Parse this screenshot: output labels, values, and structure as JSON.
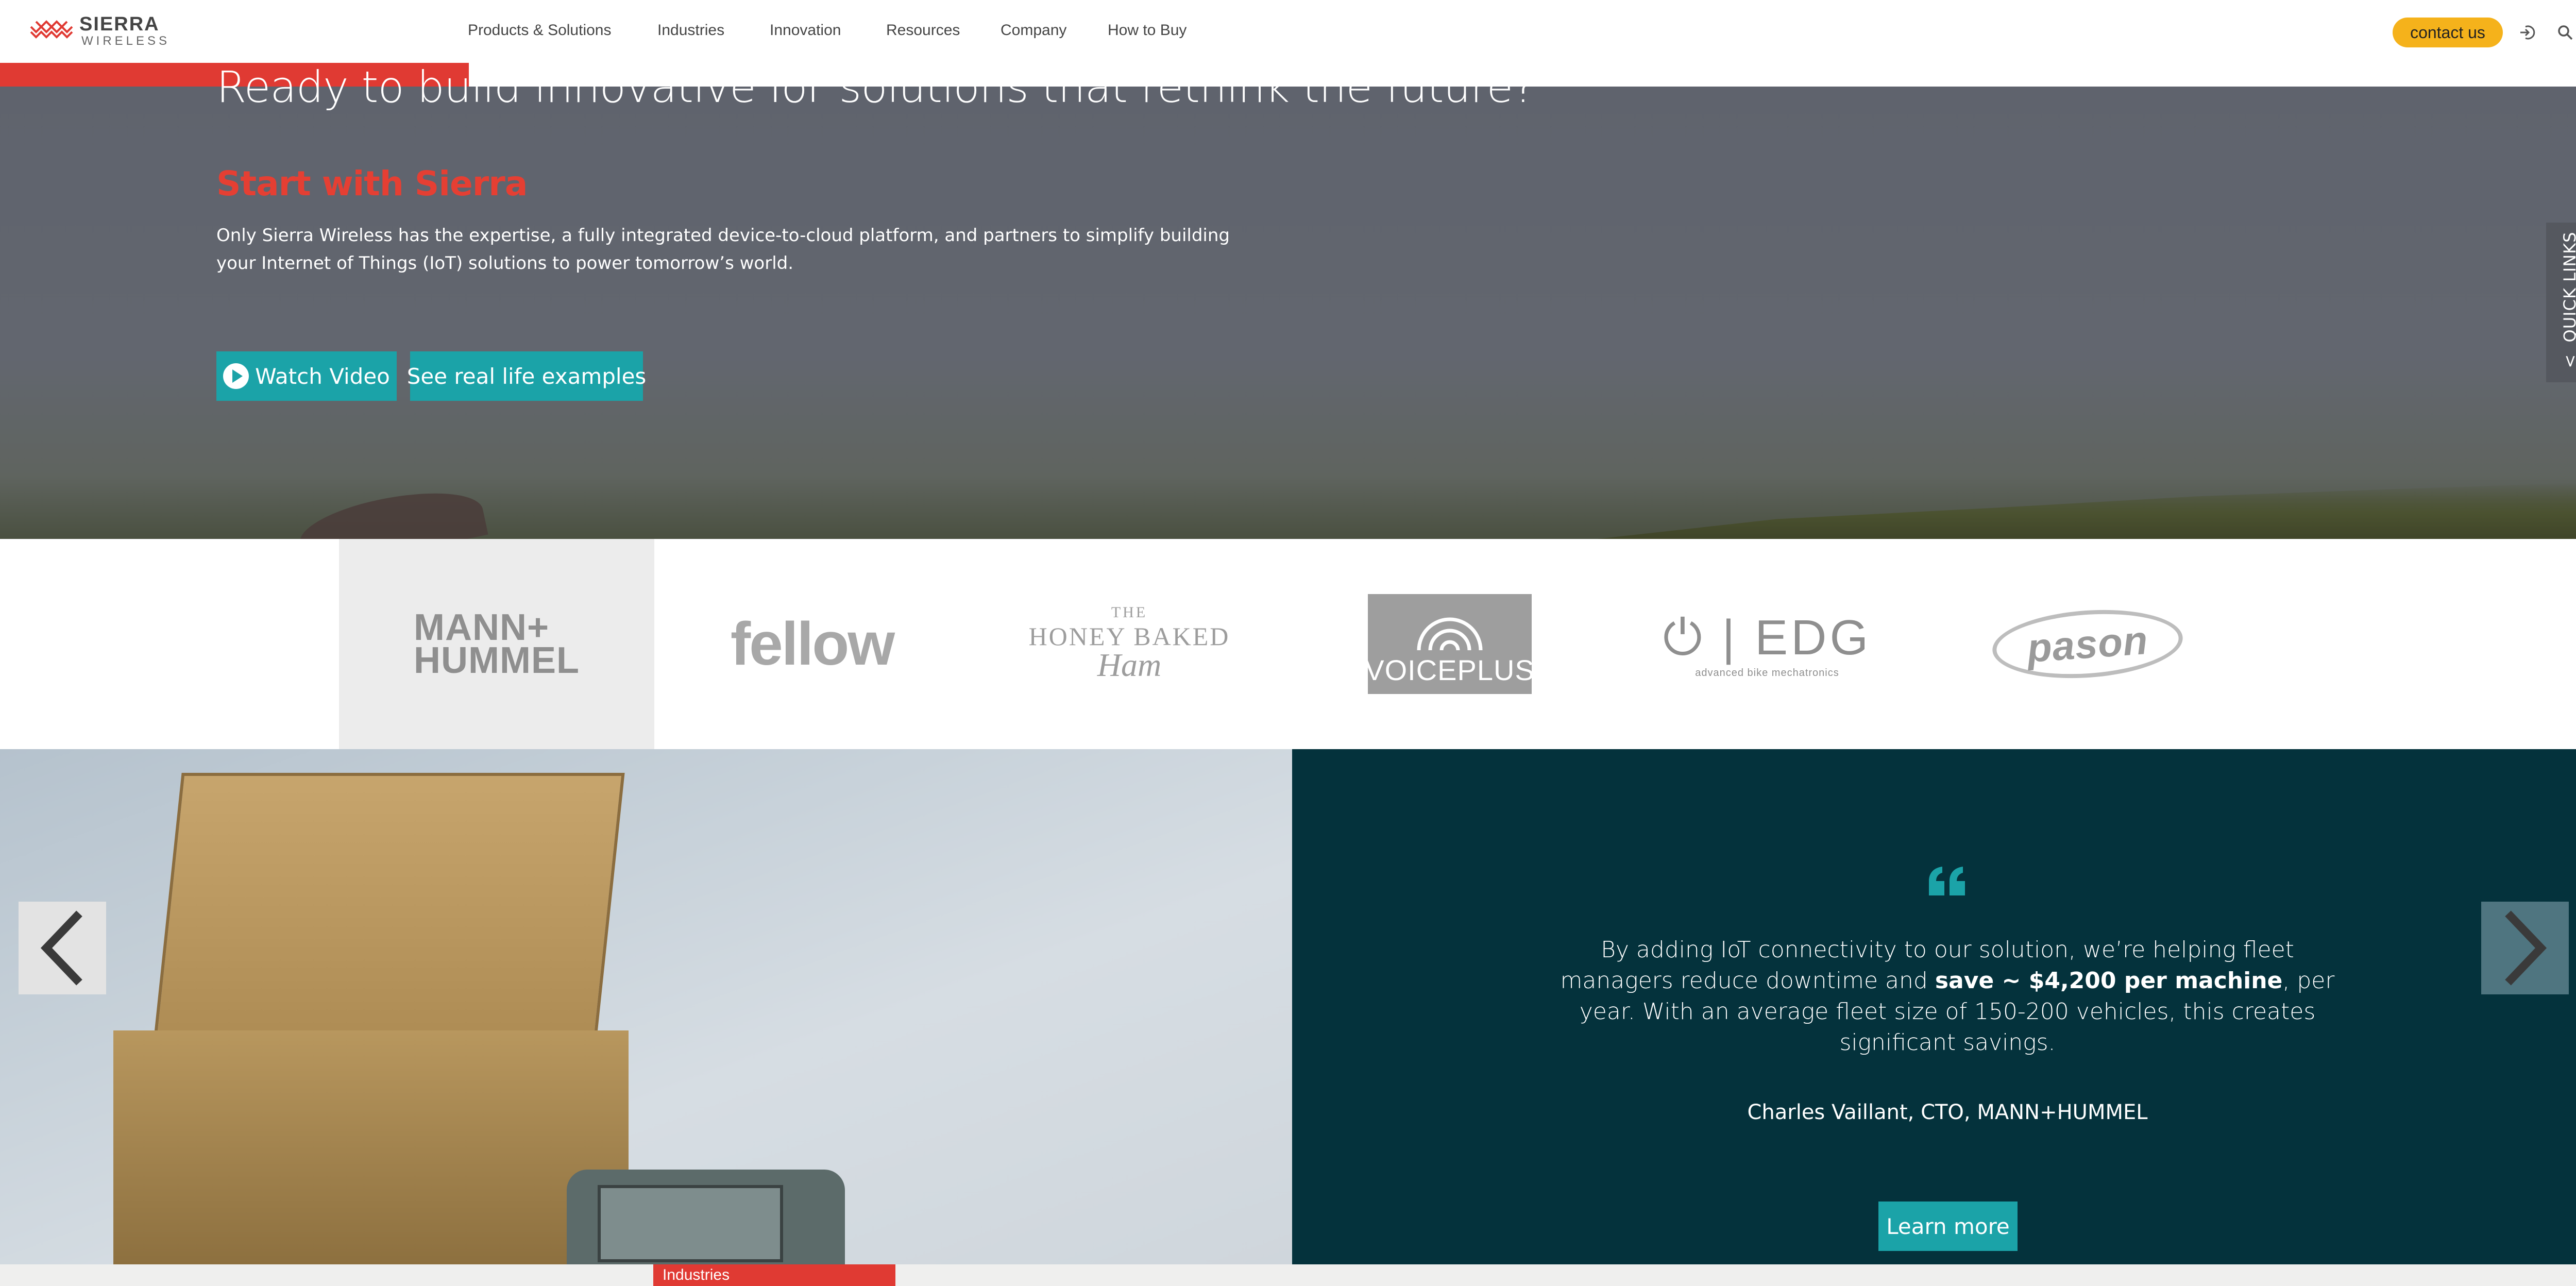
{
  "header": {
    "logo": {
      "line1": "SIERRA",
      "line2": "WIRELESS"
    },
    "nav": [
      {
        "label": "Products & Solutions"
      },
      {
        "label": "Industries"
      },
      {
        "label": "Innovation"
      },
      {
        "label": "Resources"
      },
      {
        "label": "Company"
      },
      {
        "label": "How to Buy"
      }
    ],
    "contact_label": "contact us"
  },
  "hero": {
    "title": "Ready to build innovative IoT solutions that rethink the future?",
    "subtitle": "Start with Sierra",
    "body": "Only Sierra Wireless has the expertise, a fully integrated device-to-cloud platform, and partners to simplify building your Internet of Things (IoT) solutions to power tomorrow’s world.",
    "watch_video_label": "Watch Video",
    "examples_label": "See real life examples",
    "quick_links_label": "QUICK LINKS"
  },
  "logos": {
    "mann_line1": "MANN+",
    "mann_line2": "HUMMEL",
    "fellow": "fellow",
    "honey_line1": "THE",
    "honey_line2": "HONEY BAKED",
    "honey_line3": "Ham",
    "voiceplus": "VOICEPLUS",
    "edg": "EDG",
    "edg_tagline": "advanced bike mechatronics",
    "pason": "pason"
  },
  "testimonial": {
    "quote_before": "By adding IoT connectivity to our solution, we’re helping fleet managers reduce downtime and ",
    "quote_bold": "save ~ $4,200 per machine",
    "quote_after": ", per year. With an average fleet size of 150-200 vehicles, this creates significant savings.",
    "author": "Charles Vaillant, CTO, MANN+HUMMEL",
    "learn_more_label": "Learn more"
  },
  "footer": {
    "tab_label": "Industries"
  },
  "colors": {
    "accent_red": "#e03a33",
    "teal_button": "#1ba3a8",
    "contact_yellow": "#f5b21b",
    "quote_panel": "#04323c"
  },
  "icons": {
    "login": "login-icon",
    "search": "search-icon",
    "play": "play-icon",
    "quote": "quote-icon",
    "prev": "chevron-left-icon",
    "next": "chevron-right-icon",
    "quick_links_chevron": "chevron-up-icon"
  }
}
